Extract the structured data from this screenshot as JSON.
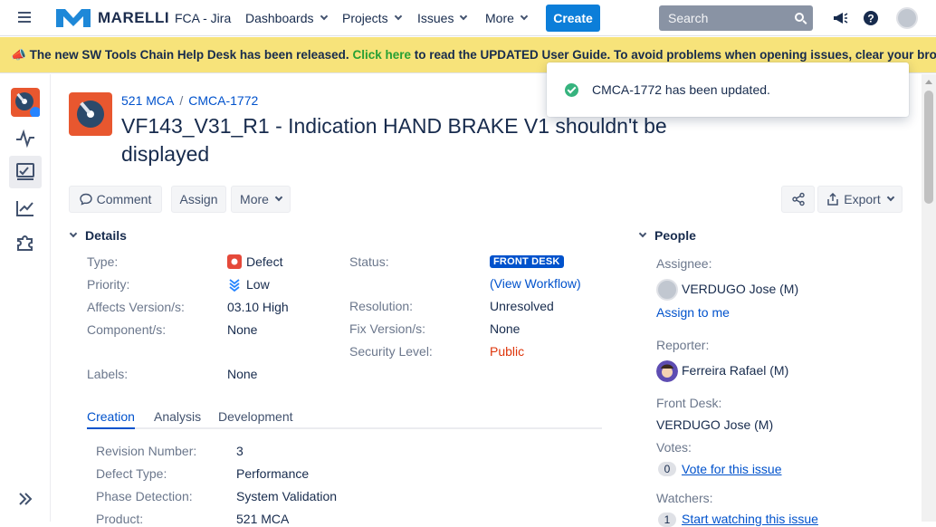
{
  "topnav": {
    "brand": "MARELLI",
    "app_name": "FCA - Jira",
    "menu": [
      "Dashboards",
      "Projects",
      "Issues",
      "More"
    ],
    "create_label": "Create",
    "search_placeholder": "Search"
  },
  "banner": {
    "text_before": "The new SW Tools Chain Help Desk has been released.",
    "link_text": "Click here",
    "text_after": "to read the UPDATED User Guide. To avoid problems when opening issues, clear your browser's"
  },
  "toast": {
    "message": "CMCA-1772 has been updated."
  },
  "breadcrumb": {
    "project": "521 MCA",
    "issue_key": "CMCA-1772"
  },
  "issue": {
    "summary": "VF143_V31_R1 - Indication HAND BRAKE V1 shouldn't be displayed"
  },
  "toolbar": {
    "comment": "Comment",
    "assign": "Assign",
    "more": "More",
    "export": "Export"
  },
  "details": {
    "heading": "Details",
    "type_label": "Type:",
    "type_value": "Defect",
    "priority_label": "Priority:",
    "priority_value": "Low",
    "affects_label": "Affects Version/s:",
    "affects_value": "03.10 High",
    "component_label": "Component/s:",
    "component_value": "None",
    "labels_label": "Labels:",
    "labels_value": "None",
    "status_label": "Status:",
    "status_value": "FRONT DESK",
    "view_workflow": "(View Workflow)",
    "resolution_label": "Resolution:",
    "resolution_value": "Unresolved",
    "fix_label": "Fix Version/s:",
    "fix_value": "None",
    "security_label": "Security Level:",
    "security_value": "Public"
  },
  "tabs": [
    "Creation",
    "Analysis",
    "Development"
  ],
  "creation": {
    "revision_label": "Revision Number:",
    "revision_value": "3",
    "defect_type_label": "Defect Type:",
    "defect_type_value": "Performance",
    "phase_label": "Phase Detection:",
    "phase_value": "System Validation",
    "product_label": "Product:",
    "product_value": "521 MCA"
  },
  "people": {
    "heading": "People",
    "assignee_label": "Assignee:",
    "assignee_value": "VERDUGO Jose (M)",
    "assign_to_me": "Assign to me",
    "reporter_label": "Reporter:",
    "reporter_value": "Ferreira Rafael (M)",
    "front_desk_label": "Front Desk:",
    "front_desk_value": "VERDUGO Jose (M)",
    "votes_label": "Votes:",
    "votes_count": "0",
    "vote_link": "Vote for this issue",
    "watchers_label": "Watchers:",
    "watchers_count": "1",
    "watch_link": "Start watching this issue"
  },
  "colors": {
    "primary": "#0c7ed9",
    "banner_bg": "#f7e37a",
    "banner_link": "#27a034",
    "status_lozenge": "#0052cc",
    "security_public": "#de350b",
    "toast_success": "#36b37e"
  }
}
